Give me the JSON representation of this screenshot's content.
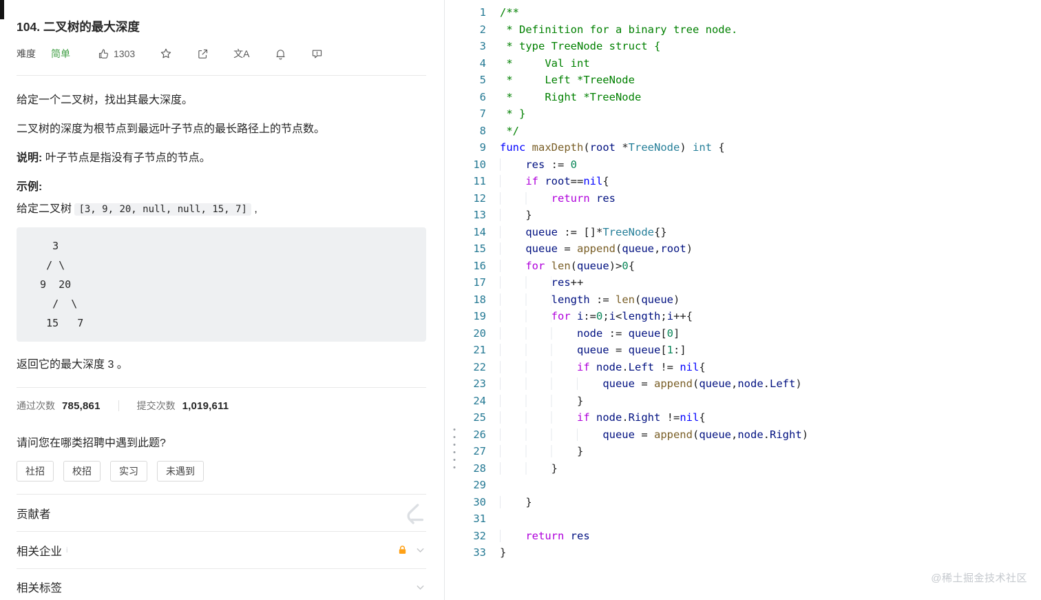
{
  "watermark": "@稀土掘金技术社区",
  "colors": {
    "difficulty_easy": "#43a047",
    "lock": "#ffa116",
    "comment": "#008000",
    "keyword": "#af00db",
    "line_number": "#237893"
  },
  "icons": {
    "translate_glyph": "文A"
  },
  "problem": {
    "title": "104. 二叉树的最大深度",
    "difficulty_label": "难度",
    "difficulty_value": "简单",
    "likes": "1303",
    "description_p1": "给定一个二叉树，找出其最大深度。",
    "description_p2": "二叉树的深度为根节点到最远叶子节点的最长路径上的节点数。",
    "note_label": "说明:",
    "note_text": " 叶子节点是指没有子节点的节点。",
    "example_label": "示例:",
    "example_prefix": "给定二叉树 ",
    "example_code": "[3, 9, 20, null, null, 15, 7]",
    "example_suffix": " ,",
    "tree_ascii": "    3\n   / \\\n  9  20\n    /  \\\n   15   7",
    "example_result": "返回它的最大深度 3 。",
    "stats": {
      "accepted_label": "通过次数",
      "accepted_value": "785,861",
      "submissions_label": "提交次数",
      "submissions_value": "1,019,611"
    },
    "survey_question": "请问您在哪类招聘中遇到此题?",
    "survey_options": [
      "社招",
      "校招",
      "实习",
      "未遇到"
    ],
    "sections": {
      "contributors": "贡献者",
      "related_companies": "相关企业",
      "related_tags": "相关标签"
    }
  },
  "editor": {
    "language": "go",
    "lines": [
      {
        "n": 1,
        "t": [
          [
            "cm",
            "/**"
          ]
        ]
      },
      {
        "n": 2,
        "t": [
          [
            "cm",
            " * Definition for a binary tree node."
          ]
        ]
      },
      {
        "n": 3,
        "t": [
          [
            "cm",
            " * type TreeNode struct {"
          ]
        ]
      },
      {
        "n": 4,
        "t": [
          [
            "cm",
            " *     Val int"
          ]
        ]
      },
      {
        "n": 5,
        "t": [
          [
            "cm",
            " *     Left *TreeNode"
          ]
        ]
      },
      {
        "n": 6,
        "t": [
          [
            "cm",
            " *     Right *TreeNode"
          ]
        ]
      },
      {
        "n": 7,
        "t": [
          [
            "cm",
            " * }"
          ]
        ]
      },
      {
        "n": 8,
        "t": [
          [
            "cm",
            " */"
          ]
        ]
      },
      {
        "n": 9,
        "t": [
          [
            "kwb",
            "func"
          ],
          [
            "pl",
            " "
          ],
          [
            "fn",
            "maxDepth"
          ],
          [
            "pl",
            "("
          ],
          [
            "vr",
            "root"
          ],
          [
            "pl",
            " *"
          ],
          [
            "ty",
            "TreeNode"
          ],
          [
            "pl",
            ") "
          ],
          [
            "ty",
            "int"
          ],
          [
            "pl",
            " {"
          ]
        ]
      },
      {
        "n": 10,
        "t": [
          [
            "pl",
            "    "
          ],
          [
            "vr",
            "res"
          ],
          [
            "pl",
            " := "
          ],
          [
            "num",
            "0"
          ]
        ]
      },
      {
        "n": 11,
        "t": [
          [
            "pl",
            "    "
          ],
          [
            "kwp",
            "if"
          ],
          [
            "pl",
            " "
          ],
          [
            "vr",
            "root"
          ],
          [
            "pl",
            "=="
          ],
          [
            "nil",
            "nil"
          ],
          [
            "pl",
            "{"
          ]
        ]
      },
      {
        "n": 12,
        "t": [
          [
            "pl",
            "        "
          ],
          [
            "kwp",
            "return"
          ],
          [
            "pl",
            " "
          ],
          [
            "vr",
            "res"
          ]
        ]
      },
      {
        "n": 13,
        "t": [
          [
            "pl",
            "    }"
          ]
        ]
      },
      {
        "n": 14,
        "t": [
          [
            "pl",
            "    "
          ],
          [
            "vr",
            "queue"
          ],
          [
            "pl",
            " := []*"
          ],
          [
            "ty",
            "TreeNode"
          ],
          [
            "pl",
            "{}"
          ]
        ]
      },
      {
        "n": 15,
        "t": [
          [
            "pl",
            "    "
          ],
          [
            "vr",
            "queue"
          ],
          [
            "pl",
            " = "
          ],
          [
            "fn",
            "append"
          ],
          [
            "pl",
            "("
          ],
          [
            "vr",
            "queue"
          ],
          [
            "pl",
            ","
          ],
          [
            "vr",
            "root"
          ],
          [
            "pl",
            ")"
          ]
        ]
      },
      {
        "n": 16,
        "t": [
          [
            "pl",
            "    "
          ],
          [
            "kwp",
            "for"
          ],
          [
            "pl",
            " "
          ],
          [
            "fn",
            "len"
          ],
          [
            "pl",
            "("
          ],
          [
            "vr",
            "queue"
          ],
          [
            "pl",
            ")>"
          ],
          [
            "num",
            "0"
          ],
          [
            "pl",
            "{"
          ]
        ]
      },
      {
        "n": 17,
        "t": [
          [
            "pl",
            "        "
          ],
          [
            "vr",
            "res"
          ],
          [
            "pl",
            "++"
          ]
        ]
      },
      {
        "n": 18,
        "t": [
          [
            "pl",
            "        "
          ],
          [
            "vr",
            "length"
          ],
          [
            "pl",
            " := "
          ],
          [
            "fn",
            "len"
          ],
          [
            "pl",
            "("
          ],
          [
            "vr",
            "queue"
          ],
          [
            "pl",
            ")"
          ]
        ]
      },
      {
        "n": 19,
        "t": [
          [
            "pl",
            "        "
          ],
          [
            "kwp",
            "for"
          ],
          [
            "pl",
            " "
          ],
          [
            "vr",
            "i"
          ],
          [
            "pl",
            ":="
          ],
          [
            "num",
            "0"
          ],
          [
            "pl",
            ";"
          ],
          [
            "vr",
            "i"
          ],
          [
            "pl",
            "<"
          ],
          [
            "vr",
            "length"
          ],
          [
            "pl",
            ";"
          ],
          [
            "vr",
            "i"
          ],
          [
            "pl",
            "++{"
          ]
        ]
      },
      {
        "n": 20,
        "t": [
          [
            "pl",
            "            "
          ],
          [
            "vr",
            "node"
          ],
          [
            "pl",
            " := "
          ],
          [
            "vr",
            "queue"
          ],
          [
            "pl",
            "["
          ],
          [
            "num",
            "0"
          ],
          [
            "pl",
            "]"
          ]
        ]
      },
      {
        "n": 21,
        "t": [
          [
            "pl",
            "            "
          ],
          [
            "vr",
            "queue"
          ],
          [
            "pl",
            " = "
          ],
          [
            "vr",
            "queue"
          ],
          [
            "pl",
            "["
          ],
          [
            "num",
            "1"
          ],
          [
            "pl",
            ":]"
          ]
        ]
      },
      {
        "n": 22,
        "t": [
          [
            "pl",
            "            "
          ],
          [
            "kwp",
            "if"
          ],
          [
            "pl",
            " "
          ],
          [
            "vr",
            "node"
          ],
          [
            "pl",
            "."
          ],
          [
            "vr",
            "Left"
          ],
          [
            "pl",
            " != "
          ],
          [
            "nil",
            "nil"
          ],
          [
            "pl",
            "{"
          ]
        ]
      },
      {
        "n": 23,
        "t": [
          [
            "pl",
            "                "
          ],
          [
            "vr",
            "queue"
          ],
          [
            "pl",
            " = "
          ],
          [
            "fn",
            "append"
          ],
          [
            "pl",
            "("
          ],
          [
            "vr",
            "queue"
          ],
          [
            "pl",
            ","
          ],
          [
            "vr",
            "node"
          ],
          [
            "pl",
            "."
          ],
          [
            "vr",
            "Left"
          ],
          [
            "pl",
            ")"
          ]
        ]
      },
      {
        "n": 24,
        "t": [
          [
            "pl",
            "            }"
          ]
        ]
      },
      {
        "n": 25,
        "t": [
          [
            "pl",
            "            "
          ],
          [
            "kwp",
            "if"
          ],
          [
            "pl",
            " "
          ],
          [
            "vr",
            "node"
          ],
          [
            "pl",
            "."
          ],
          [
            "vr",
            "Right"
          ],
          [
            "pl",
            " !="
          ],
          [
            "nil",
            "nil"
          ],
          [
            "pl",
            "{"
          ]
        ]
      },
      {
        "n": 26,
        "t": [
          [
            "pl",
            "                "
          ],
          [
            "vr",
            "queue"
          ],
          [
            "pl",
            " = "
          ],
          [
            "fn",
            "append"
          ],
          [
            "pl",
            "("
          ],
          [
            "vr",
            "queue"
          ],
          [
            "pl",
            ","
          ],
          [
            "vr",
            "node"
          ],
          [
            "pl",
            "."
          ],
          [
            "vr",
            "Right"
          ],
          [
            "pl",
            ")"
          ]
        ]
      },
      {
        "n": 27,
        "t": [
          [
            "pl",
            "            }"
          ]
        ]
      },
      {
        "n": 28,
        "t": [
          [
            "pl",
            "        }"
          ]
        ]
      },
      {
        "n": 29,
        "t": []
      },
      {
        "n": 30,
        "t": [
          [
            "pl",
            "    }"
          ]
        ]
      },
      {
        "n": 31,
        "t": []
      },
      {
        "n": 32,
        "t": [
          [
            "pl",
            "    "
          ],
          [
            "kwp",
            "return"
          ],
          [
            "pl",
            " "
          ],
          [
            "vr",
            "res"
          ]
        ]
      },
      {
        "n": 33,
        "t": [
          [
            "pl",
            "}"
          ]
        ]
      }
    ]
  }
}
